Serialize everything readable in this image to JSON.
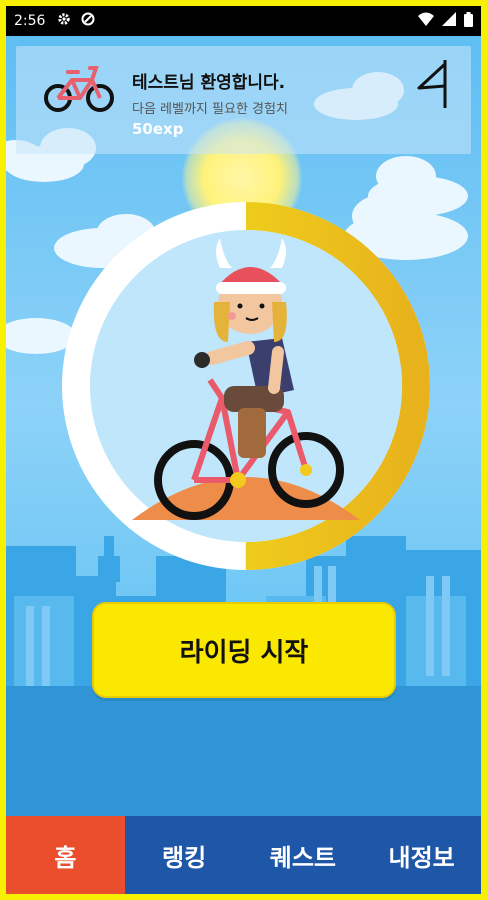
{
  "status_bar": {
    "time": "2:56",
    "icons": [
      "gear-icon",
      "data-saver-icon",
      "wifi-icon",
      "signal-icon",
      "battery-icon"
    ]
  },
  "header": {
    "welcome": "테스트님 환영합니다.",
    "next_level_label": "다음 레벨까지 필요한 경험치",
    "exp": "50exp"
  },
  "main": {
    "ride_button_label": "라이딩 시작",
    "progress_fraction": 0.5
  },
  "bottom_nav": {
    "tabs": [
      {
        "label": "홈",
        "active": true
      },
      {
        "label": "랭킹",
        "active": false
      },
      {
        "label": "퀘스트",
        "active": false
      },
      {
        "label": "내정보",
        "active": false
      }
    ]
  },
  "colors": {
    "accent_yellow": "#fbe800",
    "nav_blue": "#1e56a8",
    "nav_active": "#ea4e2d",
    "progress_gradient_start": "#f5e61a",
    "progress_gradient_end": "#e8b21c"
  }
}
